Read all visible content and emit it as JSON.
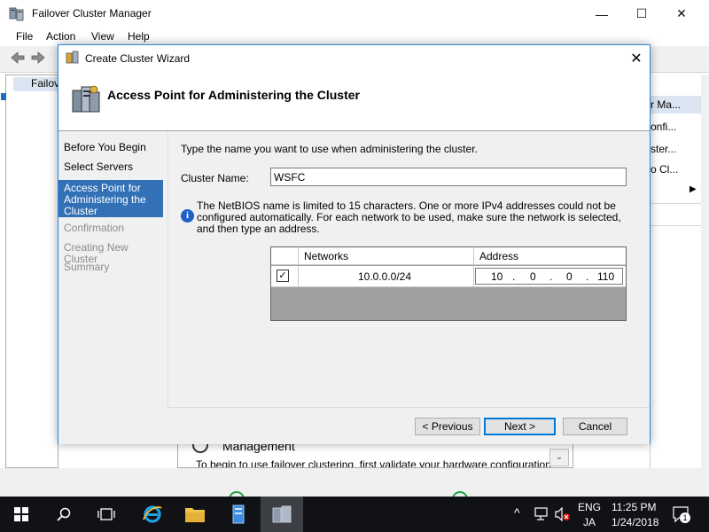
{
  "main_window": {
    "title": "Failover Cluster Manager",
    "minimize": "—",
    "maximize": "☐",
    "close": "✕",
    "menu": [
      "File",
      "Action",
      "View",
      "Help"
    ],
    "tree_root": "Failov",
    "actions_header": "r Ma...",
    "actions_items": [
      "onfi...",
      "ster...",
      "o Cl..."
    ],
    "actions_submenu_arrow": "▶",
    "center_title": "Management",
    "center_hint": "To begin to use failover clustering, first validate your hardware configuration",
    "scroll_down": "⌄"
  },
  "wizard": {
    "title": "Create Cluster Wizard",
    "close": "✕",
    "header_title": "Access Point for Administering the Cluster",
    "steps": [
      {
        "label": "Before You Begin",
        "state": "done"
      },
      {
        "label": "Select Servers",
        "state": "done"
      },
      {
        "label": "Access Point for Administering the Cluster",
        "state": "active"
      },
      {
        "label": "Confirmation",
        "state": "disabled"
      },
      {
        "label": "Creating New Cluster",
        "state": "disabled"
      },
      {
        "label": "Summary",
        "state": "disabled"
      }
    ],
    "prompt": "Type the name you want to use when administering the cluster.",
    "cluster_name_label": "Cluster Name:",
    "cluster_name_value": "WSFC",
    "info_icon": "i",
    "info_text": "The NetBIOS name is limited to 15 characters.  One or more IPv4 addresses could not be configured automatically.  For each network to be used, make sure the network is selected, and then type an address.",
    "grid": {
      "columns": [
        "Networks",
        "Address"
      ],
      "rows": [
        {
          "checked": true,
          "check_glyph": "✓",
          "network": "10.0.0.0/24",
          "address": [
            "10",
            "0",
            "0",
            "110"
          ]
        }
      ],
      "ip_separator": "."
    },
    "buttons": {
      "previous": "< Previous",
      "next": "Next >",
      "cancel": "Cancel"
    }
  },
  "taskbar": {
    "language_top": "ENG",
    "language_bottom": "JA",
    "time": "11:25 PM",
    "date": "1/24/2018",
    "notification_count": "1",
    "tray_chevron": "^"
  },
  "colors": {
    "accent": "#0078d7",
    "selection": "#3371b6",
    "taskbar": "#101216",
    "info_blue": "#1d60c8"
  }
}
